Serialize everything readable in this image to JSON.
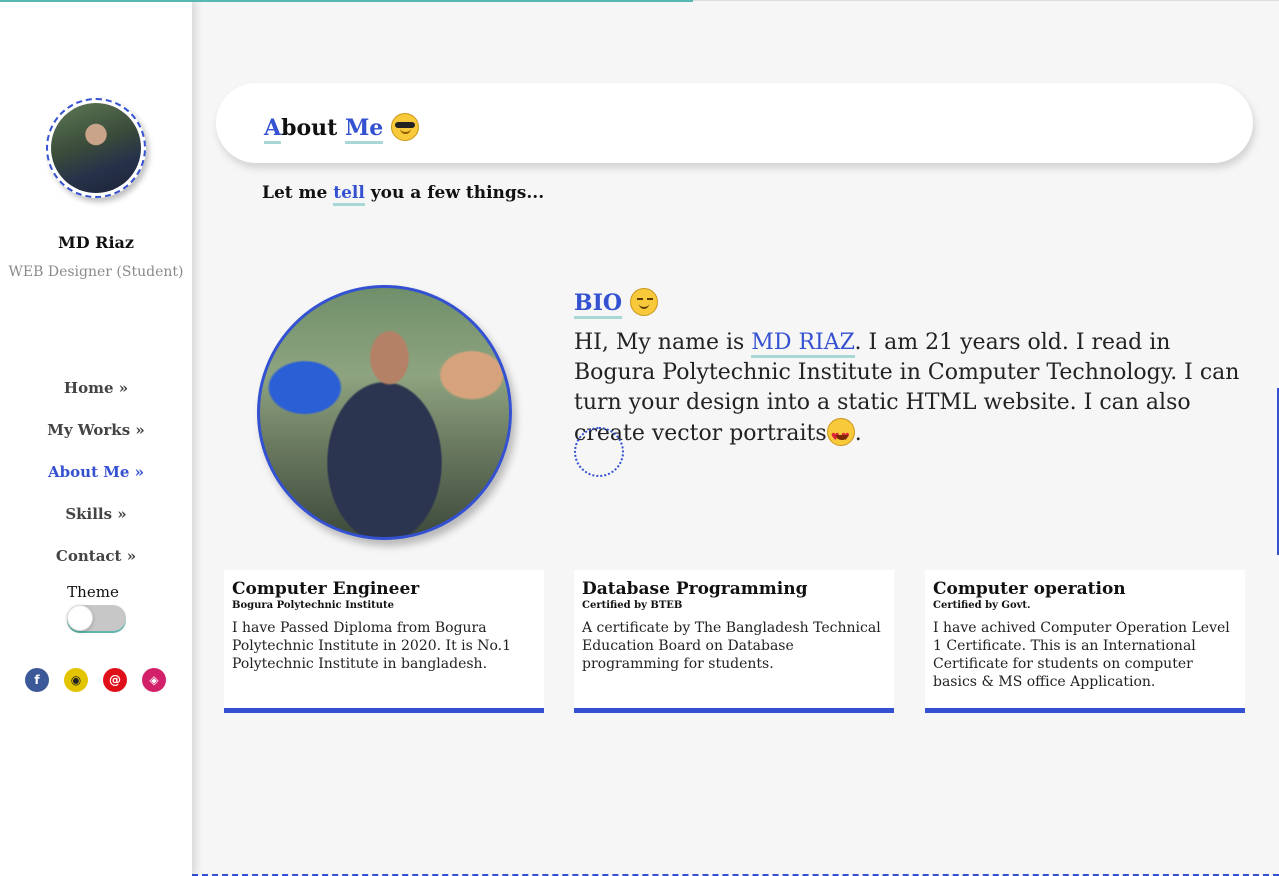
{
  "sidebar": {
    "name": "MD Riaz",
    "role": "WEB Designer (Student)",
    "nav": [
      {
        "label": "Home »",
        "active": false
      },
      {
        "label": "My Works »",
        "active": false
      },
      {
        "label": "About Me »",
        "active": true
      },
      {
        "label": "Skills »",
        "active": false
      },
      {
        "label": "Contact »",
        "active": false
      }
    ],
    "theme_label": "Theme",
    "socials": [
      {
        "icon": "facebook-icon",
        "glyph": "f",
        "color": "#3b5998"
      },
      {
        "icon": "github-icon",
        "glyph": "◉",
        "color": "#e2c400"
      },
      {
        "icon": "email-icon",
        "glyph": "@",
        "color": "#e0101b"
      },
      {
        "icon": "codepen-icon",
        "glyph": "◈",
        "color": "#d3206a"
      }
    ]
  },
  "header": {
    "title_first_letter": "A",
    "title_rest": "bout ",
    "title_highlight": "Me",
    "emoji": "sunglasses-emoji"
  },
  "intro": {
    "before": "Let me ",
    "highlight": "tell",
    "after": " you a few things..."
  },
  "bio": {
    "title": "BIO",
    "emoji": "wink-emoji",
    "text_before": "HI, My name is ",
    "name": "MD RIAZ",
    "text_after": ". I am 21 years old. I read in Bogura Polytechnic Institute in Computer Technology. I can turn your design into a static HTML website. I can also create vector portraits",
    "end_emoji": "heart-eyes-emoji",
    "text_end": "."
  },
  "cards": [
    {
      "title": "Computer Engineer",
      "subtitle": "Bogura Polytechnic Institute",
      "body": "I have Passed Diploma from Bogura Polytechnic Institute in 2020. It is No.1 Polytechnic Institute in bangladesh."
    },
    {
      "title": "Database Programming",
      "subtitle": "Certified by BTEB",
      "body": "A certificate by The Bangladesh Technical Education Board on Database programming for students."
    },
    {
      "title": "Computer operation",
      "subtitle": "Certified by Govt.",
      "body": "I have achived Computer Operation Level 1 Certificate. This is an International Certificate for students on computer basics & MS office Application."
    }
  ],
  "colors": {
    "accent": "#3451d1",
    "teal": "#a7d8d6"
  }
}
